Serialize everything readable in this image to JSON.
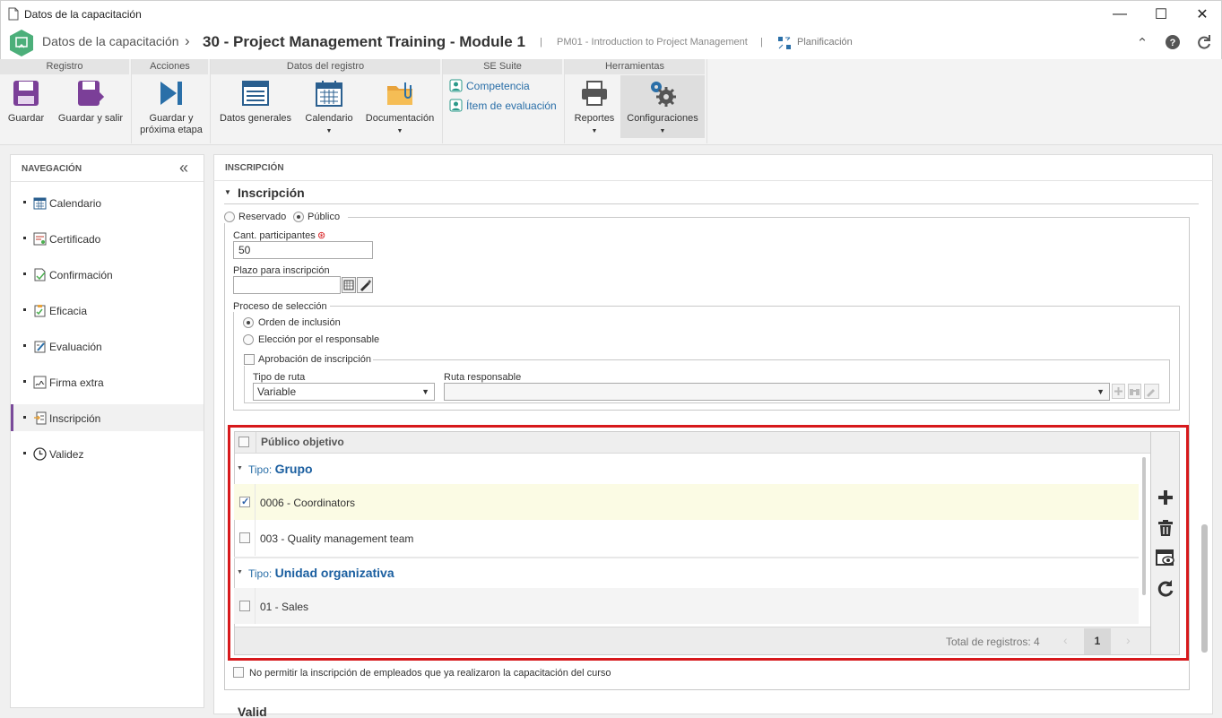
{
  "window": {
    "title": "Datos de la capacitación",
    "min_label": "—",
    "max_label": "☐",
    "close_label": "✕"
  },
  "header": {
    "breadcrumb": "Datos de la capacitación",
    "separator": "›",
    "record_title": "30 - Project Management Training - Module 1",
    "divider": "|",
    "subtitle": "PM01 - Introduction to Project Management",
    "planning": "Planificación"
  },
  "ribbon": {
    "groups": [
      "Registro",
      "Acciones",
      "Datos del registro",
      "SE Suite",
      "Herramientas"
    ],
    "guardar": "Guardar",
    "guardar_salir": "Guardar y salir",
    "guardar_proxima_1": "Guardar y",
    "guardar_proxima_2": "próxima etapa",
    "datos_generales": "Datos generales",
    "calendario": "Calendario",
    "documentacion": "Documentación",
    "competencia": "Competencia",
    "item_evaluacion": "Ítem de evaluación",
    "reportes": "Reportes",
    "configuraciones": "Configuraciones",
    "dropdown_caret": "▼"
  },
  "nav": {
    "title": "NAVEGACIÓN",
    "collapse": "«",
    "items": [
      "Calendario",
      "Certificado",
      "Confirmación",
      "Eficacia",
      "Evaluación",
      "Firma extra",
      "Inscripción",
      "Validez"
    ]
  },
  "main": {
    "section_header": "INSCRIPCIÓN",
    "section_title": "Inscripción",
    "collapse_arrow": "▼",
    "reservado": "Reservado",
    "publico": "Público",
    "cant_label": "Cant. participantes",
    "required_mark": "⊛",
    "cant_value": "50",
    "plazo_label": "Plazo para inscripción",
    "plazo_value": "",
    "proceso_label": "Proceso de selección",
    "orden": "Orden de inclusión",
    "eleccion": "Elección por el responsable",
    "aprobacion": "Aprobación de inscripción",
    "tipo_ruta_label": "Tipo de ruta",
    "tipo_ruta_value": "Variable",
    "ruta_resp_label": "Ruta responsable",
    "ruta_resp_value": "",
    "grid_header": "Público objetivo",
    "group1_prefix": "Tipo:",
    "group1_name": "Grupo",
    "row1": "0006 - Coordinators",
    "row2": "003 - Quality management team",
    "group2_prefix": "Tipo:",
    "group2_name": "Unidad organizativa",
    "row3": "01 - Sales",
    "total": "Total de registros: 4",
    "page": "1",
    "prev": "‹",
    "next": "›",
    "no_permitir": "No permitir la inscripción de empleados que ya realizaron la capacitación del curso",
    "validez_peek": "Valid"
  },
  "colors": {
    "accent": "#2a6fa8",
    "highlight_row": "#fbfbe4",
    "red_frame": "#d7191c",
    "nav_active": "#7a4a9a"
  }
}
